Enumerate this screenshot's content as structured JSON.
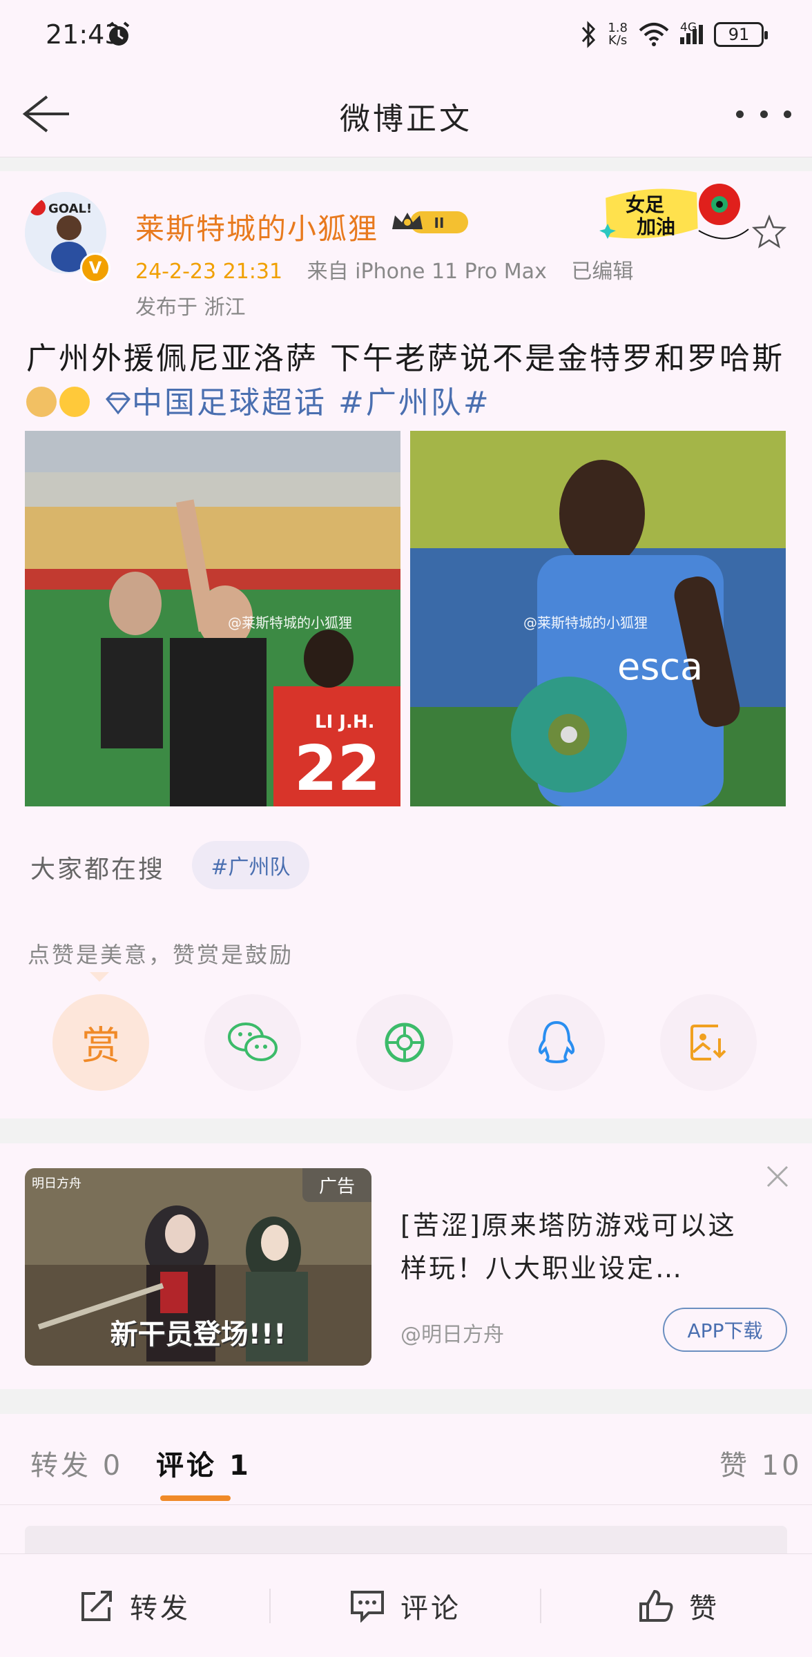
{
  "status_bar": {
    "time": "21:43",
    "net_speed_value": "1.8",
    "net_speed_unit": "K/s",
    "network": "4G",
    "battery": "91"
  },
  "nav": {
    "title": "微博正文"
  },
  "post": {
    "author": "莱斯特城的小狐狸",
    "level_badge": "II",
    "date": "24-2-23 21:31",
    "source": "来自 iPhone 11 Pro Max",
    "edited": "已编辑",
    "location": "发布于 浙江",
    "text": "广州外援佩尼亚洛萨 下午老萨说不是金特罗和罗哈斯",
    "super_topic": "中国足球超话",
    "hashtag": "#广州队#",
    "avatar_text": "GOAL!",
    "sticker_line1": "女足",
    "sticker_line2": "加油",
    "images": [
      {
        "watermark": "@莱斯特城的小狐狸",
        "jersey_name": "LI J.H.",
        "jersey_number": "22"
      },
      {
        "watermark": "@莱斯特城的小狐狸",
        "shirt_text": "esca"
      }
    ]
  },
  "search": {
    "label": "大家都在搜",
    "chip": "#广州队"
  },
  "reward": {
    "text": "点赞是美意，赞赏是鼓励",
    "button": "赏"
  },
  "share_icons": [
    "reward-icon",
    "wechat-icon",
    "moments-icon",
    "qq-icon",
    "save-image-icon"
  ],
  "ad": {
    "tag": "广告",
    "logo": "明日方舟",
    "banner": "新干员登场!!!",
    "title": "[苦涩]原来塔防游戏可以这样玩！八大职业设定…",
    "source": "@明日方舟",
    "button": "APP下载"
  },
  "tabs": {
    "repost_label": "转发",
    "repost_count": "0",
    "comment_label": "评论",
    "comment_count": "1",
    "like_label": "赞",
    "like_count": "10"
  },
  "bottom_bar": {
    "repost": "转发",
    "comment": "评论",
    "like": "赞"
  },
  "colors": {
    "accent": "#f08a28",
    "link": "#4a6fb0",
    "date": "#f0a000",
    "username": "#e87a1e"
  }
}
